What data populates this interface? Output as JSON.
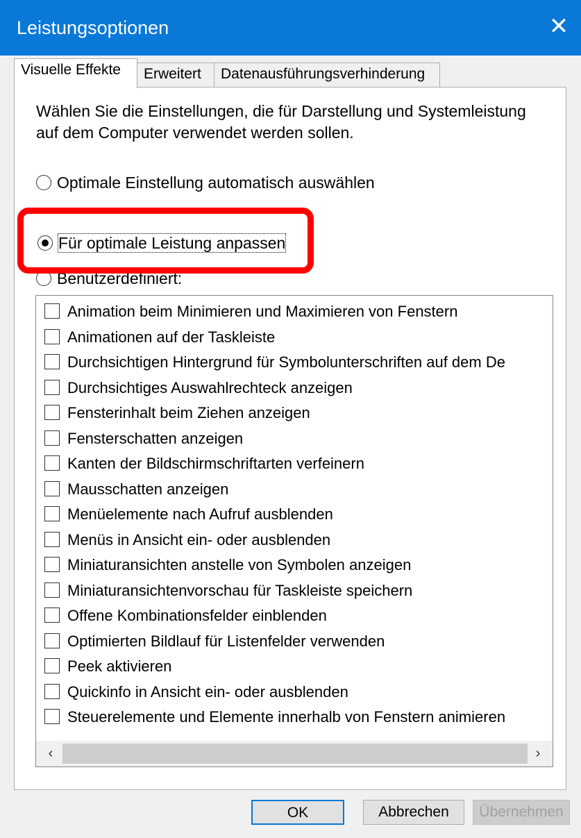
{
  "window": {
    "title": "Leistungsoptionen",
    "close_glyph": "✕",
    "titlebar_color": "#0a78d7"
  },
  "tabs": [
    {
      "label": "Visuelle Effekte"
    },
    {
      "label": "Erweitert"
    },
    {
      "label": "Datenausführungsverhinderung"
    }
  ],
  "description": "Wählen Sie die Einstellungen, die für Darstellung und Systemleistung auf dem Computer verwendet werden sollen.",
  "radios": [
    {
      "label": "Optimale Einstellung automatisch auswählen",
      "checked": false
    },
    {
      "label": "Für optimale Leistung anpassen",
      "checked": true
    },
    {
      "label": "Benutzerdefiniert:",
      "checked": false
    }
  ],
  "highlight_color": "#ff0000",
  "effects": [
    {
      "label": "Animation beim Minimieren und Maximieren von Fenstern",
      "checked": false
    },
    {
      "label": "Animationen auf der Taskleiste",
      "checked": false
    },
    {
      "label": "Durchsichtigen Hintergrund für Symbolunterschriften auf dem De",
      "checked": false
    },
    {
      "label": "Durchsichtiges Auswahlrechteck anzeigen",
      "checked": false
    },
    {
      "label": "Fensterinhalt beim Ziehen anzeigen",
      "checked": false
    },
    {
      "label": "Fensterschatten anzeigen",
      "checked": false
    },
    {
      "label": "Kanten der Bildschirmschriftarten verfeinern",
      "checked": false
    },
    {
      "label": "Mausschatten anzeigen",
      "checked": false
    },
    {
      "label": "Menüelemente nach Aufruf ausblenden",
      "checked": false
    },
    {
      "label": "Menüs in Ansicht ein- oder ausblenden",
      "checked": false
    },
    {
      "label": "Miniaturansichten anstelle von Symbolen anzeigen",
      "checked": false
    },
    {
      "label": "Miniaturansichtenvorschau für Taskleiste speichern",
      "checked": false
    },
    {
      "label": "Offene Kombinationsfelder einblenden",
      "checked": false
    },
    {
      "label": "Optimierten Bildlauf für Listenfelder verwenden",
      "checked": false
    },
    {
      "label": "Peek aktivieren",
      "checked": false
    },
    {
      "label": "Quickinfo in Ansicht ein- oder ausblenden",
      "checked": false
    },
    {
      "label": "Steuerelemente und Elemente innerhalb von Fenstern animieren",
      "checked": false
    }
  ],
  "scrollbar": {
    "left_glyph": "‹",
    "right_glyph": "›"
  },
  "buttons": {
    "ok": "OK",
    "cancel": "Abbrechen",
    "apply": "Übernehmen"
  }
}
